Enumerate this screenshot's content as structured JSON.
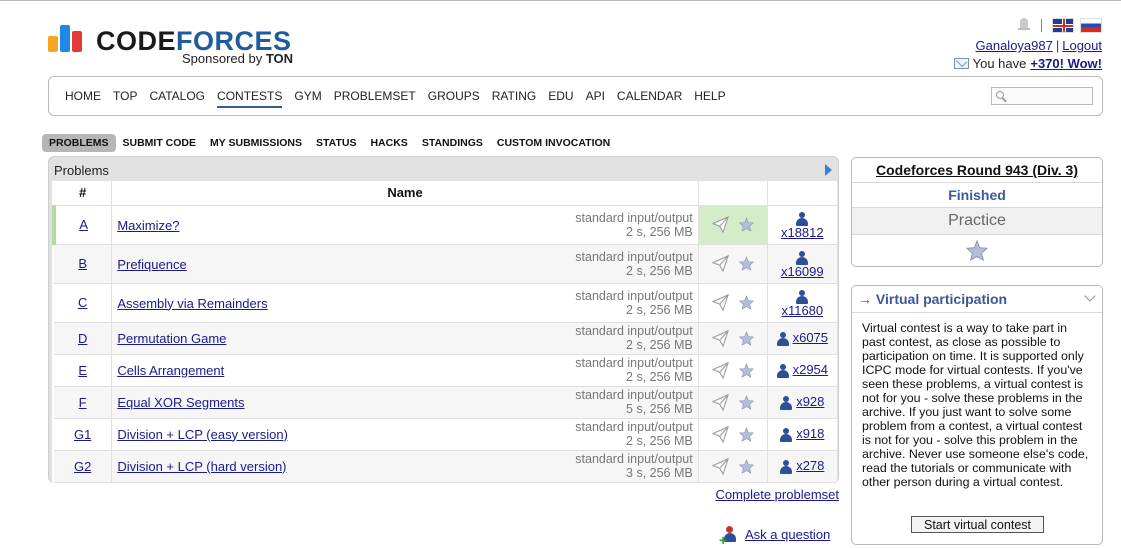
{
  "header": {
    "logo_text_code": "CODE",
    "logo_text_forces": "FORCES",
    "sponsor_prefix": "Sponsored by ",
    "sponsor_name": "TON",
    "username": "Ganaloya987",
    "separator": "|",
    "logout": "Logout",
    "message_prefix": "You have",
    "message_link": "+370! Wow!"
  },
  "main_nav": {
    "items": [
      "HOME",
      "TOP",
      "CATALOG",
      "CONTESTS",
      "GYM",
      "PROBLEMSET",
      "GROUPS",
      "RATING",
      "EDU",
      "API",
      "CALENDAR",
      "HELP"
    ],
    "active": "CONTESTS",
    "search_value": ""
  },
  "sub_nav": {
    "items": [
      "PROBLEMS",
      "SUBMIT CODE",
      "MY SUBMISSIONS",
      "STATUS",
      "HACKS",
      "STANDINGS",
      "CUSTOM INVOCATION"
    ],
    "active": "PROBLEMS"
  },
  "problems": {
    "caption": "Problems",
    "columns": {
      "index": "#",
      "name": "Name"
    },
    "rows": [
      {
        "index": "A",
        "name": "Maximize?",
        "io": "standard input/output",
        "limits": "2 s, 256 MB",
        "solved": "x18812",
        "accepted": true
      },
      {
        "index": "B",
        "name": "Prefiquence",
        "io": "standard input/output",
        "limits": "2 s, 256 MB",
        "solved": "x16099",
        "accepted": false
      },
      {
        "index": "C",
        "name": "Assembly via Remainders",
        "io": "standard input/output",
        "limits": "2 s, 256 MB",
        "solved": "x11680",
        "accepted": false
      },
      {
        "index": "D",
        "name": "Permutation Game",
        "io": "standard input/output",
        "limits": "2 s, 256 MB",
        "solved": "x6075",
        "accepted": false
      },
      {
        "index": "E",
        "name": "Cells Arrangement",
        "io": "standard input/output",
        "limits": "2 s, 256 MB",
        "solved": "x2954",
        "accepted": false
      },
      {
        "index": "F",
        "name": "Equal XOR Segments",
        "io": "standard input/output",
        "limits": "5 s, 256 MB",
        "solved": "x928",
        "accepted": false
      },
      {
        "index": "G1",
        "name": "Division + LCP (easy version)",
        "io": "standard input/output",
        "limits": "2 s, 256 MB",
        "solved": "x918",
        "accepted": false
      },
      {
        "index": "G2",
        "name": "Division + LCP (hard version)",
        "io": "standard input/output",
        "limits": "3 s, 256 MB",
        "solved": "x278",
        "accepted": false
      }
    ],
    "complete_problemset": "Complete problemset",
    "ask_question": "Ask a question"
  },
  "contest_box": {
    "title": "Codeforces Round 943 (Div. 3)",
    "status": "Finished",
    "practice": "Practice"
  },
  "virtual_box": {
    "title": "→ Virtual participation",
    "text": "Virtual contest is a way to take part in past contest, as close as possible to participation on time. It is supported only ICPC mode for virtual contests. If you've seen these problems, a virtual contest is not for you - solve these problems in the archive. If you just want to solve some problem from a contest, a virtual contest is not for you - solve this problem in the archive. Never use someone else's code, read the tutorials or communicate with other person during a virtual contest.",
    "button": "Start virtual contest"
  },
  "colors": {
    "brand_blue": "#1f5c9b",
    "link": "#1a1a8c",
    "accepted_bg": "#d4edc9",
    "accent_blue": "#3b5998"
  }
}
